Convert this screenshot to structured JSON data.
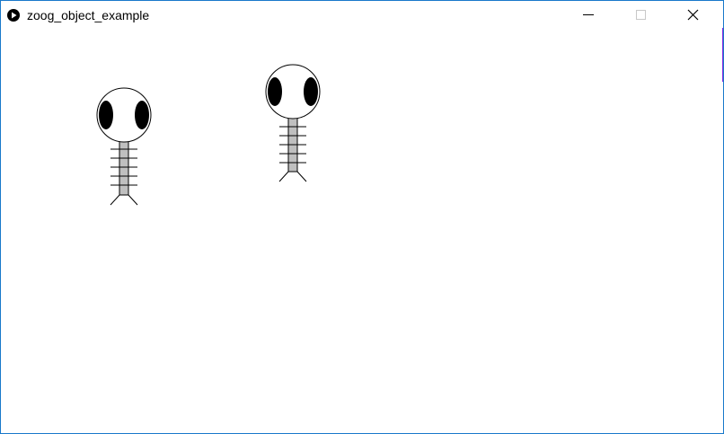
{
  "window": {
    "title": "zoog_object_example",
    "app_icon": "play-icon",
    "controls": {
      "minimize_icon": "minimize-icon",
      "maximize_icon": "maximize-icon",
      "close_icon": "close-icon"
    },
    "border_color": "#1979ca"
  },
  "canvas": {
    "background": "#ffffff",
    "zoogs": [
      {
        "name": "zoog-1",
        "body_color": "#bfbfbf",
        "head_color": "#ffffff",
        "eye_color": "#000000"
      },
      {
        "name": "zoog-2",
        "body_color": "#bfbfbf",
        "head_color": "#ffffff",
        "eye_color": "#000000"
      }
    ]
  }
}
